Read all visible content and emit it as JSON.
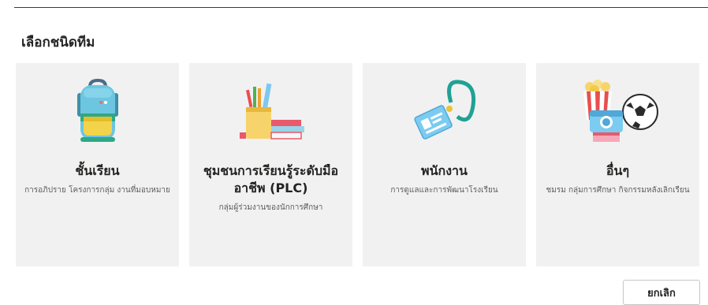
{
  "dialog": {
    "heading": "เลือกชนิดทีม",
    "cancel_label": "ยกเลิก"
  },
  "cards": [
    {
      "title": "ชั้นเรียน",
      "description": "การอภิปราย โครงการกลุ่ม งานที่มอบหมาย",
      "icon": "backpack-icon"
    },
    {
      "title": "ชุมชนการเรียนรู้ระดับมืออาชีพ (PLC)",
      "description": "กลุ่มผู้ร่วมงานของนักการศึกษา",
      "icon": "books-pencils-icon"
    },
    {
      "title": "พนักงาน",
      "description": "การดูแลและการพัฒนาโรงเรียน",
      "icon": "lanyard-badge-icon"
    },
    {
      "title": "อื่นๆ",
      "description": "ชมรม กลุ่มการศึกษา กิจกรรมหลังเลิกเรียน",
      "icon": "popcorn-camera-ball-icon"
    }
  ],
  "colors": {
    "card_background": "#f1f1f1",
    "text_primary": "#252423",
    "text_secondary": "#605e5c"
  }
}
